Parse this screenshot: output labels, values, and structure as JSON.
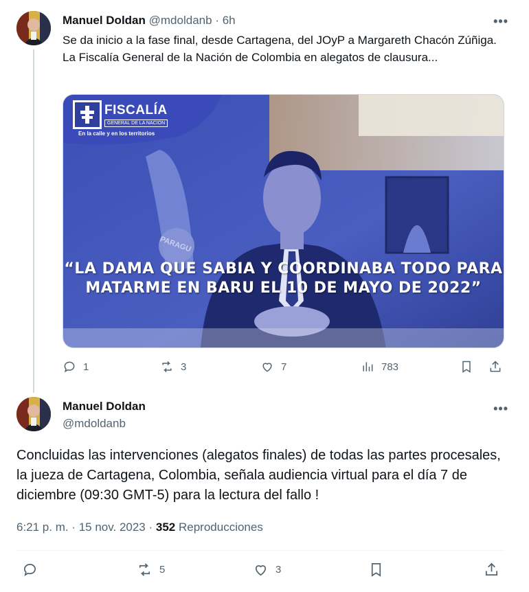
{
  "tweet1": {
    "author_name": "Manuel Doldan",
    "handle": "@mdoldanb",
    "separator": "·",
    "time": "6h",
    "text": "Se da inicio a la fase final, desde Cartagena, del JOyP a Margareth Chacón Zúñiga. La Fiscalía General de la Nación de Colombia en alegatos de clausura...",
    "media": {
      "logo_title": "FISCALÍA",
      "logo_subtitle": "GENERAL DE LA NACIÓN",
      "logo_tagline": "En la calle y en los territorios",
      "flag_text": "PARAGU",
      "caption_line1": "“LA DAMA QUE SABIA Y COORDINABA TODO PARA",
      "caption_line2": "MATARME EN BARU EL 10 DE MAYO DE 2022”"
    },
    "actions": {
      "replies": "1",
      "reposts": "3",
      "likes": "7",
      "views": "783"
    }
  },
  "tweet2": {
    "author_name": "Manuel Doldan",
    "handle": "@mdoldanb",
    "text": "Concluidas las intervenciones (alegatos finales) de todas las partes procesales, la jueza de Cartagena, Colombia, señala audiencia virtual para el día 7 de diciembre (09:30 GMT-5) para la lectura del fallo !",
    "time": "6:21 p. m.",
    "date": "15 nov. 2023",
    "views_count": "352",
    "views_label": "Reproducciones",
    "actions": {
      "reposts": "5",
      "likes": "3"
    }
  },
  "icons": [
    "reply-icon",
    "repost-icon",
    "like-icon",
    "views-icon",
    "bookmark-icon",
    "share-icon",
    "more-icon"
  ],
  "colors": {
    "text": "#0f1419",
    "secondary": "#536471",
    "divider": "#eff3f4",
    "thread_line": "#cfd9de",
    "media_blue": "#3b4fb0"
  }
}
